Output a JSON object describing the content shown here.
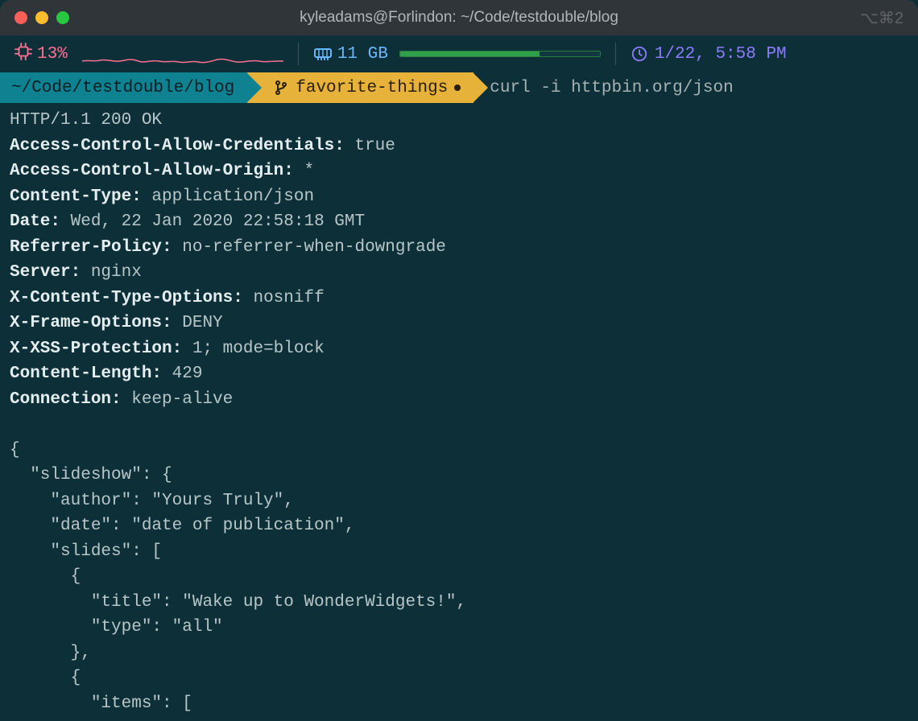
{
  "window": {
    "title": "kyleadams@Forlindon: ~/Code/testdouble/blog",
    "shortcut_symbols": "⌥⌘2"
  },
  "statbar": {
    "cpu_icon": "chip-icon",
    "cpu_percent": "13%",
    "ram_icon": "memory-icon",
    "ram_label": "11 GB",
    "clock_icon": "clock-icon",
    "clock_label": "1/22, 5:58 PM"
  },
  "powerline": {
    "path": "~/Code/testdouble/blog",
    "branch_icon": "git-branch-icon",
    "branch": "favorite-things",
    "dirty": true,
    "command": "curl -i httpbin.org/json"
  },
  "http": {
    "status_line": "HTTP/1.1 200 OK",
    "headers": [
      {
        "k": "Access-Control-Allow-Credentials",
        "v": "true"
      },
      {
        "k": "Access-Control-Allow-Origin",
        "v": "*"
      },
      {
        "k": "Content-Type",
        "v": "application/json"
      },
      {
        "k": "Date",
        "v": "Wed, 22 Jan 2020 22:58:18 GMT"
      },
      {
        "k": "Referrer-Policy",
        "v": "no-referrer-when-downgrade"
      },
      {
        "k": "Server",
        "v": "nginx"
      },
      {
        "k": "X-Content-Type-Options",
        "v": "nosniff"
      },
      {
        "k": "X-Frame-Options",
        "v": "DENY"
      },
      {
        "k": "X-XSS-Protection",
        "v": "1; mode=block"
      },
      {
        "k": "Content-Length",
        "v": "429"
      },
      {
        "k": "Connection",
        "v": "keep-alive"
      }
    ],
    "json_body_lines": [
      "{",
      "  \"slideshow\": {",
      "    \"author\": \"Yours Truly\",",
      "    \"date\": \"date of publication\",",
      "    \"slides\": [",
      "      {",
      "        \"title\": \"Wake up to WonderWidgets!\",",
      "        \"type\": \"all\"",
      "      },",
      "      {",
      "        \"items\": ["
    ]
  },
  "colors": {
    "bg": "#0d3038",
    "path_bg": "#0f8291",
    "branch_bg": "#e6b23a",
    "cpu": "#ff6f91",
    "ram": "#2fa04a",
    "clock": "#8b7cff"
  }
}
